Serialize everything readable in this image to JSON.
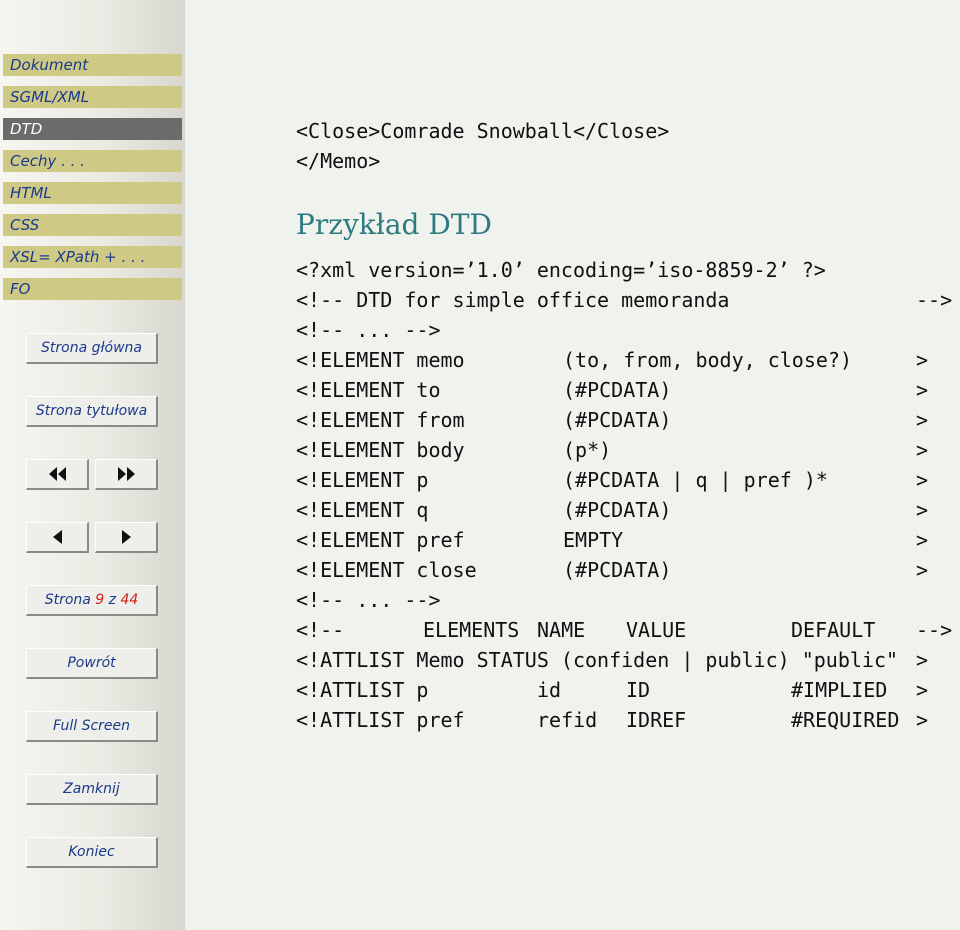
{
  "sidebar": {
    "nav_items": [
      {
        "label": "Dokument",
        "active": false
      },
      {
        "label": "SGML/XML",
        "active": false
      },
      {
        "label": "DTD",
        "active": true
      },
      {
        "label": "Cechy . . .",
        "active": false
      },
      {
        "label": "HTML",
        "active": false
      },
      {
        "label": "CSS",
        "active": false
      },
      {
        "label": "XSL= XPath + . . .",
        "active": false
      },
      {
        "label": "FO",
        "active": false
      }
    ],
    "buttons": {
      "home": "Strona główna",
      "title_page": "Strona tytułowa",
      "page_prefix": "Strona",
      "page_current": "9",
      "page_sep": "z",
      "page_total": "44",
      "back": "Powrót",
      "full_screen": "Full Screen",
      "close": "Zamknij",
      "quit": "Koniec"
    }
  },
  "content": {
    "top_lines": [
      "<Close>Comrade Snowball</Close>",
      "</Memo>"
    ],
    "heading": "Przykład DTD",
    "code_lines": [
      {
        "a": "<?xml version=’1.0’ encoding=’iso-8859-2’ ?>"
      },
      {
        "a": "<!-- DTD for simple office memoranda",
        "end": "-->"
      },
      {
        "a": "<!-- ... -->"
      },
      {
        "a": "<!ELEMENT memo",
        "b": "(to,  from, body, close?)",
        "end": ">"
      },
      {
        "a": "<!ELEMENT to",
        "b": "(#PCDATA)",
        "end": ">"
      },
      {
        "a": "<!ELEMENT from",
        "b": "(#PCDATA)",
        "end": ">"
      },
      {
        "a": "<!ELEMENT body",
        "b": "(p*)",
        "end": ">"
      },
      {
        "a": "<!ELEMENT p",
        "b": "(#PCDATA | q | pref )*",
        "end": ">"
      },
      {
        "a": "<!ELEMENT q",
        "b": "(#PCDATA)",
        "end": ">"
      },
      {
        "a": "<!ELEMENT pref",
        "b": "EMPTY",
        "end": ">"
      },
      {
        "a": "<!ELEMENT close",
        "b": "(#PCDATA)",
        "end": ">"
      },
      {
        "a": "<!-- ... -->"
      },
      {
        "a": "<!--",
        "c1": "ELEMENTS",
        "c2": "NAME",
        "c3": "VALUE",
        "c4": "DEFAULT",
        "end": "-->"
      },
      {
        "a": "<!ATTLIST Memo STATUS (confiden | public) \"public\"",
        "end": ">"
      },
      {
        "a": "<!ATTLIST p",
        "c2": "id",
        "c3": "ID",
        "c4": "#IMPLIED",
        "end": ">"
      },
      {
        "a": "<!ATTLIST pref",
        "c2": "refid",
        "c3": "IDREF",
        "c4": "#REQUIRED",
        "end": ">"
      }
    ]
  }
}
